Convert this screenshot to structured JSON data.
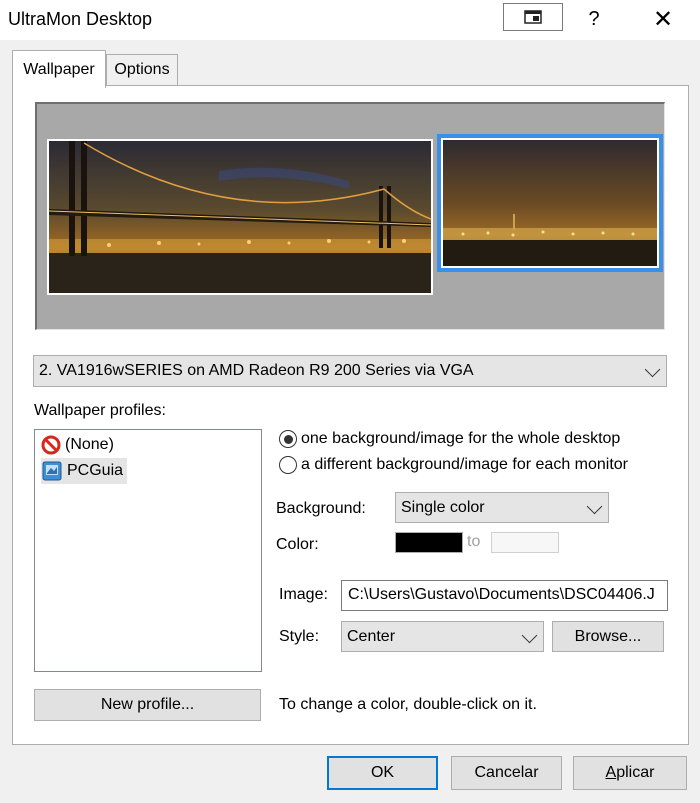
{
  "window": {
    "title": "UltraMon Desktop",
    "help_glyph": "?",
    "close_glyph": "✕"
  },
  "tabs": [
    {
      "label": "Wallpaper",
      "selected": true
    },
    {
      "label": "Options",
      "selected": false
    }
  ],
  "preview": {
    "selected_monitor": 2,
    "selection_color": "#3a8fe8"
  },
  "monitor_select": {
    "value": "2. VA1916wSERIES on AMD Radeon R9 200 Series via VGA"
  },
  "profiles": {
    "label": "Wallpaper profiles:",
    "items": [
      {
        "name": "(None)",
        "icon": "no-entry-icon"
      },
      {
        "name": "PCGuia",
        "icon": "profile-icon"
      }
    ]
  },
  "mode": {
    "option_whole": "one background/image for the whole desktop",
    "option_each": "a different background/image for each monitor",
    "selected": "whole"
  },
  "background": {
    "label": "Background:",
    "value": "Single color"
  },
  "color": {
    "label": "Color:",
    "to_label": "to",
    "color1": "#000000",
    "color2": "#f7f7f7"
  },
  "image": {
    "label": "Image:",
    "value": "C:\\Users\\Gustavo\\Documents\\DSC04406.J"
  },
  "style": {
    "label": "Style:",
    "value": "Center",
    "browse_label": "Browse..."
  },
  "new_profile_label": "New profile...",
  "hint": "To change a color, double-click on it.",
  "buttons": {
    "ok": "OK",
    "cancel": "Cancelar",
    "apply_first": "A",
    "apply_rest": "plicar"
  }
}
